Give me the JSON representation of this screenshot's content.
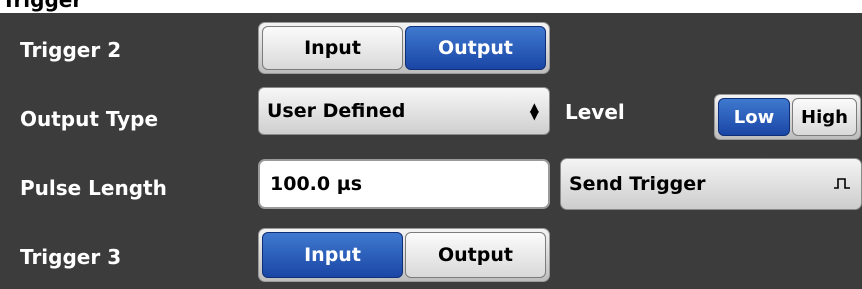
{
  "header": {
    "title_partial": "Trigger"
  },
  "trigger2": {
    "label": "Trigger 2",
    "options": [
      {
        "label": "Input",
        "active": false
      },
      {
        "label": "Output",
        "active": true
      }
    ]
  },
  "output_type": {
    "label": "Output Type",
    "value": "User Defined",
    "arrow_up": "▲",
    "arrow_down": "▼"
  },
  "level": {
    "label": "Level",
    "options": [
      {
        "label": "Low",
        "active": true
      },
      {
        "label": "High",
        "active": false
      }
    ]
  },
  "pulse_length": {
    "label": "Pulse Length",
    "value": "100.0 µs"
  },
  "send_trigger": {
    "label": "Send Trigger",
    "icon": "pulse-icon"
  },
  "trigger3": {
    "label": "Trigger 3",
    "options": [
      {
        "label": "Input",
        "active": true
      },
      {
        "label": "Output",
        "active": false
      }
    ]
  },
  "colors": {
    "background": "#3c3c3c",
    "accent": "#1a46a6",
    "label_text": "#ffffff"
  }
}
